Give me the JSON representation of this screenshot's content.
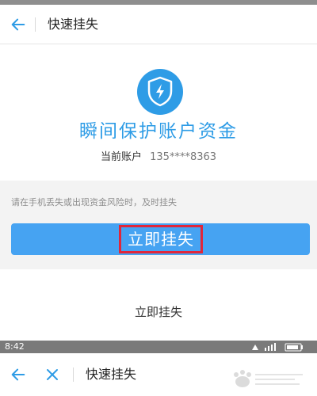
{
  "screen1": {
    "header": {
      "title": "快速挂失"
    },
    "headline": "瞬间保护账户资金",
    "account": {
      "label": "当前账户",
      "number": "135****8363"
    },
    "tip": "请在手机丢失或出现资金风险时，及时挂失",
    "primary_button_label": "立即挂失",
    "secondary_text": "立即挂失"
  },
  "screen2": {
    "status_time": "8:42",
    "header": {
      "title": "快速挂失"
    }
  },
  "icons": {
    "back": "back-arrow-icon",
    "close": "close-icon",
    "shield": "shield-lightning-icon"
  },
  "colors": {
    "accent_blue": "#2e9ce6",
    "button_blue": "#46a3f2",
    "highlight_red": "#e0263a"
  }
}
